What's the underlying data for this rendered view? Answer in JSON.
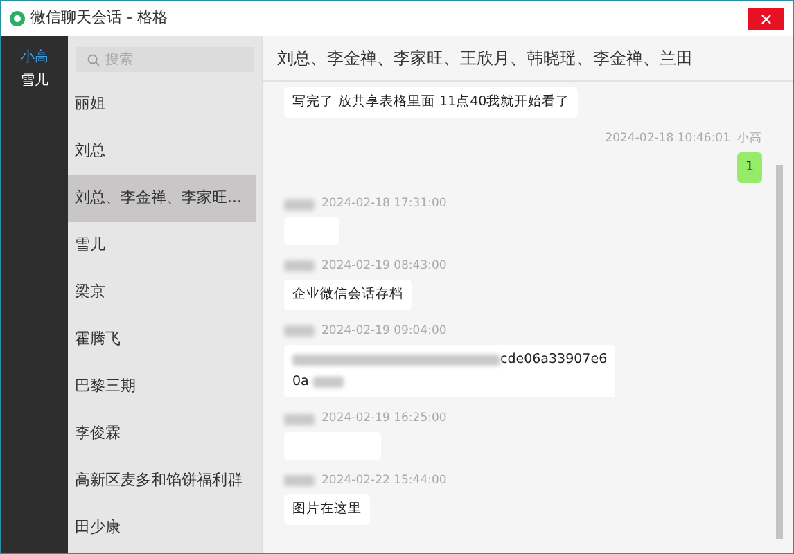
{
  "window": {
    "title": "微信聊天会话 - 格格"
  },
  "accounts": [
    {
      "name": "小高",
      "selected": true
    },
    {
      "name": "雪儿",
      "selected": false
    }
  ],
  "search": {
    "placeholder": "搜索"
  },
  "conversations": [
    {
      "name": "丽姐",
      "selected": false
    },
    {
      "name": "刘总",
      "selected": false
    },
    {
      "name": "刘总、李金禅、李家旺...",
      "selected": true
    },
    {
      "name": "雪儿",
      "selected": false
    },
    {
      "name": "梁京",
      "selected": false
    },
    {
      "name": "霍腾飞",
      "selected": false
    },
    {
      "name": "巴黎三期",
      "selected": false
    },
    {
      "name": "李俊霖",
      "selected": false
    },
    {
      "name": "高新区麦多和馅饼福利群",
      "selected": false
    },
    {
      "name": "田少康",
      "selected": false
    }
  ],
  "chat": {
    "title": "刘总、李金禅、李家旺、王欣月、韩晓瑶、李金禅、兰田",
    "messages": [
      {
        "kind": "text",
        "outgoing": false,
        "text": "写完了 放共享表格里面 11点40我就开始看了"
      },
      {
        "kind": "text",
        "outgoing": true,
        "meta": "2024-02-18 10:46:01",
        "sender": "小高",
        "text": "1"
      },
      {
        "kind": "blurred",
        "outgoing": false,
        "meta": "2024-02-18 17:31:00",
        "sender_blurred": true
      },
      {
        "kind": "text",
        "outgoing": false,
        "meta": "2024-02-19 08:43:00",
        "sender_blurred": true,
        "text": "企业微信会话存档"
      },
      {
        "kind": "link",
        "outgoing": false,
        "meta": "2024-02-19 09:04:00",
        "sender_blurred": true,
        "line1": "cde06a33907e6",
        "line2": "0a"
      },
      {
        "kind": "blurred",
        "outgoing": false,
        "meta": "2024-02-19 16:25:00",
        "sender_blurred": true
      },
      {
        "kind": "text",
        "outgoing": false,
        "meta": "2024-02-22 15:44:00",
        "sender_blurred": true,
        "text": "图片在这里"
      }
    ]
  }
}
